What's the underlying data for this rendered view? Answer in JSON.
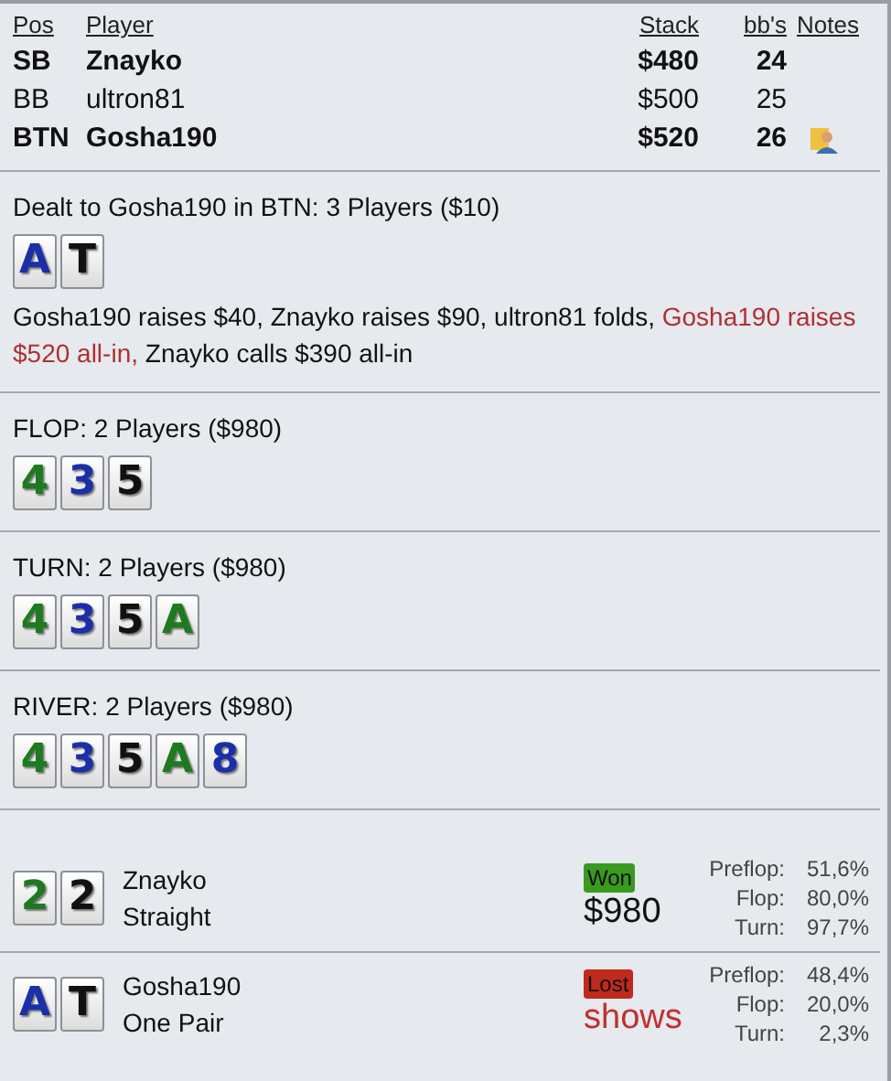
{
  "players": {
    "columns": [
      "Pos",
      "Player",
      "Stack",
      "bb's",
      "Notes"
    ],
    "rows": [
      {
        "pos": "SB",
        "player": "Znayko",
        "stack": "$480",
        "bbs": "24",
        "bold": true,
        "has_note": false
      },
      {
        "pos": "BB",
        "player": "ultron81",
        "stack": "$500",
        "bbs": "25",
        "bold": false,
        "has_note": false
      },
      {
        "pos": "BTN",
        "player": "Gosha190",
        "stack": "$520",
        "bbs": "26",
        "bold": true,
        "has_note": true
      }
    ]
  },
  "streets": [
    {
      "title": "Dealt to Gosha190 in BTN: 3 Players ($10)",
      "cards": [
        {
          "rank": "A",
          "color": "#1a2fa8"
        },
        {
          "rank": "T",
          "color": "#111111"
        }
      ],
      "actions": [
        {
          "text": "Gosha190 raises $40, Znayko raises $90, ultron81 folds, ",
          "highlight": false
        },
        {
          "text": "Gosha190 raises $520 all-in,",
          "highlight": true
        },
        {
          "text": " Znayko calls $390 all-in",
          "highlight": false
        }
      ]
    },
    {
      "title": "FLOP: 2 Players ($980)",
      "cards": [
        {
          "rank": "4",
          "color": "#1e7a1e"
        },
        {
          "rank": "3",
          "color": "#1a2fa8"
        },
        {
          "rank": "5",
          "color": "#111111"
        }
      ]
    },
    {
      "title": "TURN: 2 Players ($980)",
      "cards": [
        {
          "rank": "4",
          "color": "#1e7a1e"
        },
        {
          "rank": "3",
          "color": "#1a2fa8"
        },
        {
          "rank": "5",
          "color": "#111111"
        },
        {
          "rank": "A",
          "color": "#1e7a1e"
        }
      ]
    },
    {
      "title": "RIVER: 2 Players ($980)",
      "cards": [
        {
          "rank": "4",
          "color": "#1e7a1e"
        },
        {
          "rank": "3",
          "color": "#1a2fa8"
        },
        {
          "rank": "5",
          "color": "#111111"
        },
        {
          "rank": "A",
          "color": "#1e7a1e"
        },
        {
          "rank": "8",
          "color": "#1a2fa8"
        }
      ]
    }
  ],
  "results": [
    {
      "cards": [
        {
          "rank": "2",
          "color": "#1e7a1e"
        },
        {
          "rank": "2",
          "color": "#111111"
        }
      ],
      "player": "Znayko",
      "hand": "Straight",
      "kind": "won",
      "badge": "Won",
      "amount": "$980",
      "equity": [
        {
          "label": "Preflop:",
          "value": "51,6%"
        },
        {
          "label": "Flop:",
          "value": "80,0%"
        },
        {
          "label": "Turn:",
          "value": "97,7%"
        }
      ]
    },
    {
      "cards": [
        {
          "rank": "A",
          "color": "#1a2fa8"
        },
        {
          "rank": "T",
          "color": "#111111"
        }
      ],
      "player": "Gosha190",
      "hand": "One Pair",
      "kind": "lost",
      "badge": "Lost",
      "amount": "shows",
      "equity": [
        {
          "label": "Preflop:",
          "value": "48,4%"
        },
        {
          "label": "Flop:",
          "value": "20,0%"
        },
        {
          "label": "Turn:",
          "value": "2,3%"
        }
      ]
    }
  ]
}
